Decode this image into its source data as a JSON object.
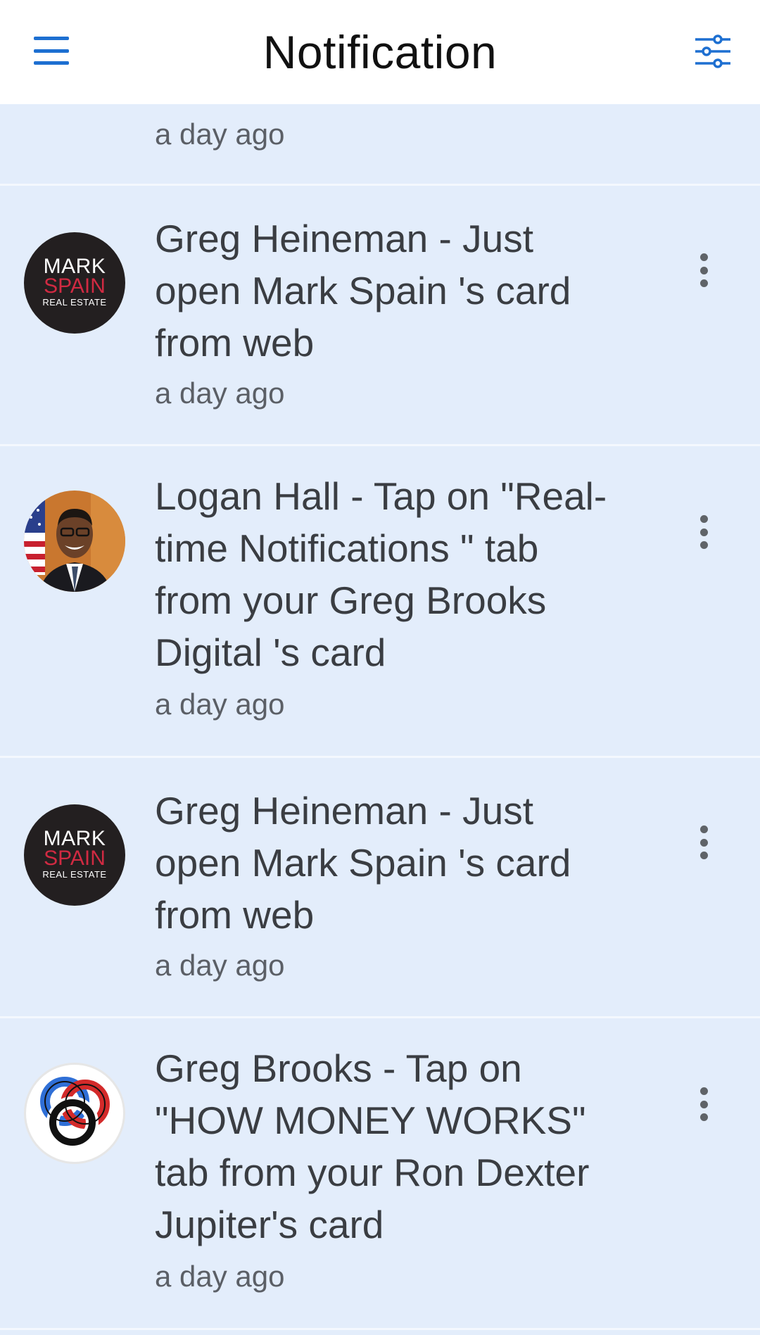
{
  "header": {
    "title": "Notification",
    "menu_icon": "hamburger-menu-icon",
    "filter_icon": "filter-sliders-icon",
    "accent": "#1d6fd1"
  },
  "notifications": [
    {
      "time": "a day ago"
    },
    {
      "message": "Greg Heineman - Just open Mark Spain 's card from web",
      "time": "a day ago",
      "logo": {
        "l1": "MARK",
        "l2": "SPAIN",
        "l3": "REAL ESTATE"
      }
    },
    {
      "message": "Logan Hall - Tap on \"Real-time Notifications \" tab from your Greg Brooks Digital 's card",
      "time": "a day ago"
    },
    {
      "message": "Greg Heineman - Just open Mark Spain 's card from web",
      "time": "a day ago",
      "logo": {
        "l1": "MARK",
        "l2": "SPAIN",
        "l3": "REAL ESTATE"
      }
    },
    {
      "message": "Greg Brooks - Tap on \"HOW MONEY WORKS\" tab from your Ron Dexter Jupiter's card",
      "time": "a day ago"
    }
  ],
  "colors": {
    "background": "#e3edfb",
    "header_bg": "#ffffff",
    "text": "#3a3d42",
    "muted": "#5b5f66"
  }
}
